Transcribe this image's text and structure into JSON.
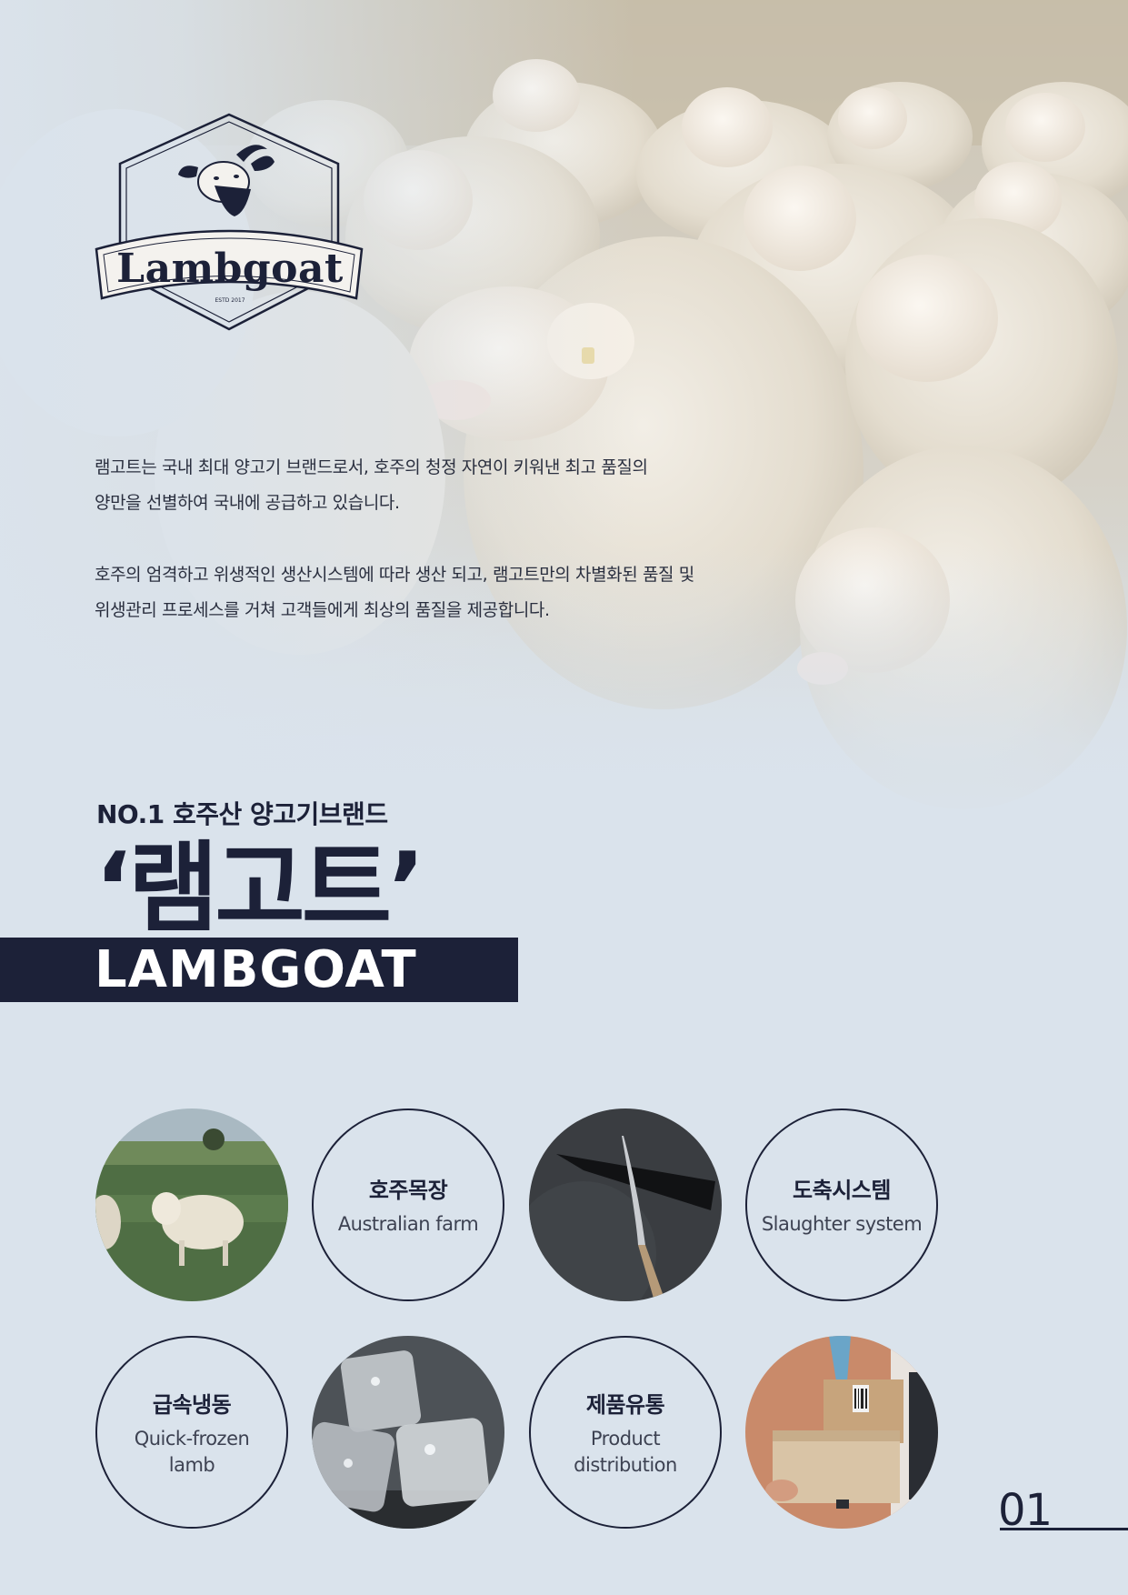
{
  "brand": {
    "logo_word": "Lambgoat",
    "logo_est": "ESTD 2017"
  },
  "intro": {
    "paragraph1_line1": "램고트는 국내 최대 양고기 브랜드로서, 호주의 청정 자연이 키워낸 최고 품질의",
    "paragraph1_line2": "양만을 선별하여 국내에 공급하고 있습니다.",
    "paragraph2_line1": "호주의 엄격하고 위생적인 생산시스템에 따라 생산 되고, 램고트만의 차별화된 품질 및",
    "paragraph2_line2": "위생관리 프로세스를 거쳐 고객들에게 최상의 품질을  제공합니다."
  },
  "headline": {
    "tagline": "NO.1 호주산 양고기브랜드",
    "title_ko": "‘램고트’",
    "title_en": "LAMBGOAT"
  },
  "features": [
    {
      "ko": "호주목장",
      "en": "Australian farm"
    },
    {
      "ko": "도축시스템",
      "en": "Slaughter system"
    },
    {
      "ko": "급속냉동",
      "en": "Quick-frozen lamb"
    },
    {
      "ko": "제품유통",
      "en": "Product distribution"
    }
  ],
  "page": {
    "number": "01"
  },
  "colors": {
    "navy": "#1c2138",
    "background": "#dae3ec"
  }
}
